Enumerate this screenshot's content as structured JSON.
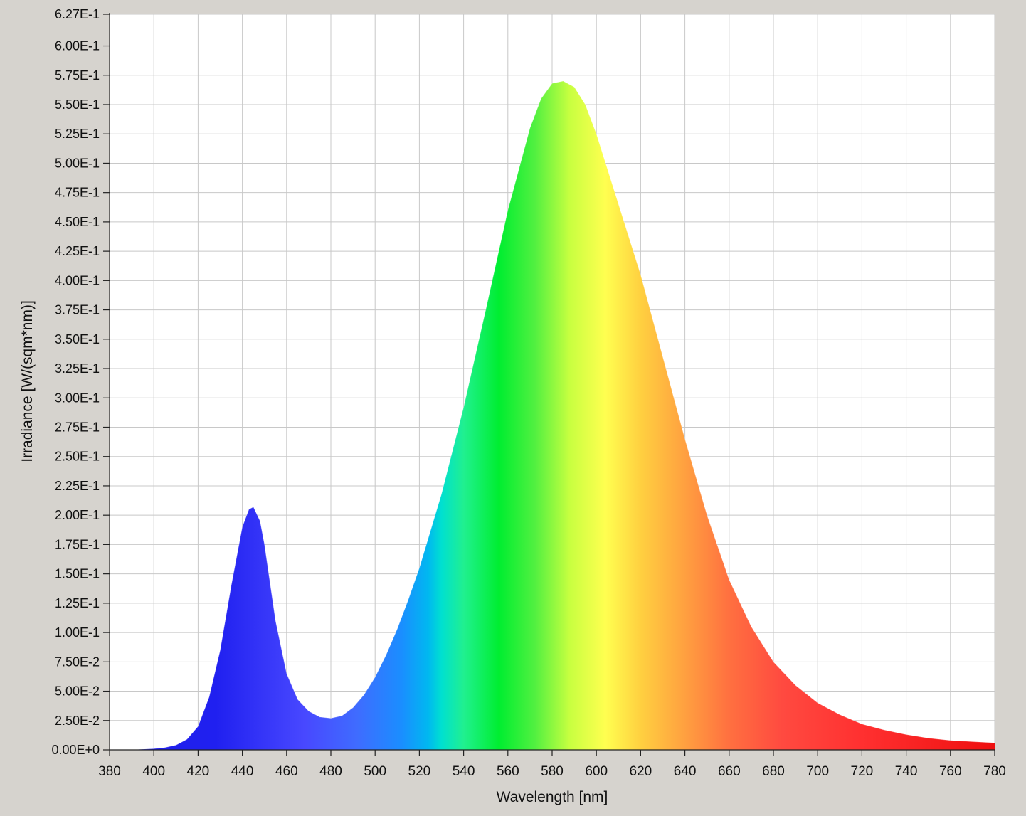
{
  "chart_data": {
    "type": "area",
    "title": "",
    "xlabel": "Wavelength [nm]",
    "ylabel": "Irradiance [W/(sqm*nm)]",
    "xlim": [
      380,
      780
    ],
    "ylim": [
      0,
      0.627
    ],
    "grid": true,
    "x_ticks": [
      380,
      400,
      420,
      440,
      460,
      480,
      500,
      520,
      540,
      560,
      580,
      600,
      620,
      640,
      660,
      680,
      700,
      720,
      740,
      760,
      780
    ],
    "x_tick_labels": [
      "380",
      "400",
      "420",
      "440",
      "460",
      "480",
      "500",
      "520",
      "540",
      "560",
      "580",
      "600",
      "620",
      "640",
      "660",
      "680",
      "700",
      "720",
      "740",
      "760",
      "780"
    ],
    "y_ticks": [
      0,
      0.025,
      0.05,
      0.075,
      0.1,
      0.125,
      0.15,
      0.175,
      0.2,
      0.225,
      0.25,
      0.275,
      0.3,
      0.325,
      0.35,
      0.375,
      0.4,
      0.425,
      0.45,
      0.475,
      0.5,
      0.525,
      0.55,
      0.575,
      0.6,
      0.627
    ],
    "y_tick_labels": [
      "0.00E+0",
      "2.50E-2",
      "5.00E-2",
      "7.50E-2",
      "1.00E-1",
      "1.25E-1",
      "1.50E-1",
      "1.75E-1",
      "2.00E-1",
      "2.25E-1",
      "2.50E-1",
      "2.75E-1",
      "3.00E-1",
      "3.25E-1",
      "3.50E-1",
      "3.75E-1",
      "4.00E-1",
      "4.25E-1",
      "4.50E-1",
      "4.75E-1",
      "5.00E-1",
      "5.25E-1",
      "5.50E-1",
      "5.75E-1",
      "6.00E-1",
      "6.27E-1"
    ],
    "series": [
      {
        "x": [
          380,
          390,
          395,
          400,
          405,
          410,
          415,
          420,
          425,
          430,
          435,
          440,
          443,
          445,
          448,
          450,
          455,
          460,
          465,
          470,
          475,
          480,
          485,
          490,
          495,
          500,
          505,
          510,
          515,
          520,
          530,
          540,
          550,
          560,
          570,
          575,
          580,
          585,
          590,
          595,
          600,
          610,
          620,
          630,
          640,
          650,
          660,
          670,
          680,
          690,
          700,
          710,
          720,
          730,
          740,
          750,
          760,
          770,
          780
        ],
        "y": [
          0,
          0,
          0.0005,
          0.001,
          0.002,
          0.004,
          0.009,
          0.02,
          0.045,
          0.085,
          0.14,
          0.19,
          0.205,
          0.207,
          0.195,
          0.175,
          0.11,
          0.065,
          0.043,
          0.033,
          0.028,
          0.027,
          0.029,
          0.036,
          0.047,
          0.062,
          0.081,
          0.103,
          0.128,
          0.155,
          0.218,
          0.292,
          0.375,
          0.46,
          0.53,
          0.555,
          0.568,
          0.57,
          0.565,
          0.55,
          0.525,
          0.465,
          0.405,
          0.335,
          0.265,
          0.2,
          0.145,
          0.105,
          0.075,
          0.055,
          0.04,
          0.03,
          0.022,
          0.017,
          0.013,
          0.01,
          0.008,
          0.007,
          0.006
        ]
      }
    ]
  }
}
